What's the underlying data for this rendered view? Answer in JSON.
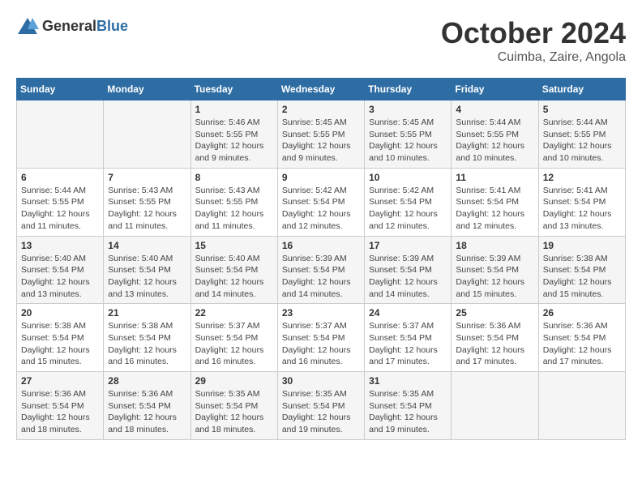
{
  "header": {
    "logo_general": "General",
    "logo_blue": "Blue",
    "month_title": "October 2024",
    "location": "Cuimba, Zaire, Angola"
  },
  "days_of_week": [
    "Sunday",
    "Monday",
    "Tuesday",
    "Wednesday",
    "Thursday",
    "Friday",
    "Saturday"
  ],
  "weeks": [
    [
      {
        "day": "",
        "info": ""
      },
      {
        "day": "",
        "info": ""
      },
      {
        "day": "1",
        "info": "Sunrise: 5:46 AM\nSunset: 5:55 PM\nDaylight: 12 hours and 9 minutes."
      },
      {
        "day": "2",
        "info": "Sunrise: 5:45 AM\nSunset: 5:55 PM\nDaylight: 12 hours and 9 minutes."
      },
      {
        "day": "3",
        "info": "Sunrise: 5:45 AM\nSunset: 5:55 PM\nDaylight: 12 hours and 10 minutes."
      },
      {
        "day": "4",
        "info": "Sunrise: 5:44 AM\nSunset: 5:55 PM\nDaylight: 12 hours and 10 minutes."
      },
      {
        "day": "5",
        "info": "Sunrise: 5:44 AM\nSunset: 5:55 PM\nDaylight: 12 hours and 10 minutes."
      }
    ],
    [
      {
        "day": "6",
        "info": "Sunrise: 5:44 AM\nSunset: 5:55 PM\nDaylight: 12 hours and 11 minutes."
      },
      {
        "day": "7",
        "info": "Sunrise: 5:43 AM\nSunset: 5:55 PM\nDaylight: 12 hours and 11 minutes."
      },
      {
        "day": "8",
        "info": "Sunrise: 5:43 AM\nSunset: 5:55 PM\nDaylight: 12 hours and 11 minutes."
      },
      {
        "day": "9",
        "info": "Sunrise: 5:42 AM\nSunset: 5:54 PM\nDaylight: 12 hours and 12 minutes."
      },
      {
        "day": "10",
        "info": "Sunrise: 5:42 AM\nSunset: 5:54 PM\nDaylight: 12 hours and 12 minutes."
      },
      {
        "day": "11",
        "info": "Sunrise: 5:41 AM\nSunset: 5:54 PM\nDaylight: 12 hours and 12 minutes."
      },
      {
        "day": "12",
        "info": "Sunrise: 5:41 AM\nSunset: 5:54 PM\nDaylight: 12 hours and 13 minutes."
      }
    ],
    [
      {
        "day": "13",
        "info": "Sunrise: 5:40 AM\nSunset: 5:54 PM\nDaylight: 12 hours and 13 minutes."
      },
      {
        "day": "14",
        "info": "Sunrise: 5:40 AM\nSunset: 5:54 PM\nDaylight: 12 hours and 13 minutes."
      },
      {
        "day": "15",
        "info": "Sunrise: 5:40 AM\nSunset: 5:54 PM\nDaylight: 12 hours and 14 minutes."
      },
      {
        "day": "16",
        "info": "Sunrise: 5:39 AM\nSunset: 5:54 PM\nDaylight: 12 hours and 14 minutes."
      },
      {
        "day": "17",
        "info": "Sunrise: 5:39 AM\nSunset: 5:54 PM\nDaylight: 12 hours and 14 minutes."
      },
      {
        "day": "18",
        "info": "Sunrise: 5:39 AM\nSunset: 5:54 PM\nDaylight: 12 hours and 15 minutes."
      },
      {
        "day": "19",
        "info": "Sunrise: 5:38 AM\nSunset: 5:54 PM\nDaylight: 12 hours and 15 minutes."
      }
    ],
    [
      {
        "day": "20",
        "info": "Sunrise: 5:38 AM\nSunset: 5:54 PM\nDaylight: 12 hours and 15 minutes."
      },
      {
        "day": "21",
        "info": "Sunrise: 5:38 AM\nSunset: 5:54 PM\nDaylight: 12 hours and 16 minutes."
      },
      {
        "day": "22",
        "info": "Sunrise: 5:37 AM\nSunset: 5:54 PM\nDaylight: 12 hours and 16 minutes."
      },
      {
        "day": "23",
        "info": "Sunrise: 5:37 AM\nSunset: 5:54 PM\nDaylight: 12 hours and 16 minutes."
      },
      {
        "day": "24",
        "info": "Sunrise: 5:37 AM\nSunset: 5:54 PM\nDaylight: 12 hours and 17 minutes."
      },
      {
        "day": "25",
        "info": "Sunrise: 5:36 AM\nSunset: 5:54 PM\nDaylight: 12 hours and 17 minutes."
      },
      {
        "day": "26",
        "info": "Sunrise: 5:36 AM\nSunset: 5:54 PM\nDaylight: 12 hours and 17 minutes."
      }
    ],
    [
      {
        "day": "27",
        "info": "Sunrise: 5:36 AM\nSunset: 5:54 PM\nDaylight: 12 hours and 18 minutes."
      },
      {
        "day": "28",
        "info": "Sunrise: 5:36 AM\nSunset: 5:54 PM\nDaylight: 12 hours and 18 minutes."
      },
      {
        "day": "29",
        "info": "Sunrise: 5:35 AM\nSunset: 5:54 PM\nDaylight: 12 hours and 18 minutes."
      },
      {
        "day": "30",
        "info": "Sunrise: 5:35 AM\nSunset: 5:54 PM\nDaylight: 12 hours and 19 minutes."
      },
      {
        "day": "31",
        "info": "Sunrise: 5:35 AM\nSunset: 5:54 PM\nDaylight: 12 hours and 19 minutes."
      },
      {
        "day": "",
        "info": ""
      },
      {
        "day": "",
        "info": ""
      }
    ]
  ]
}
